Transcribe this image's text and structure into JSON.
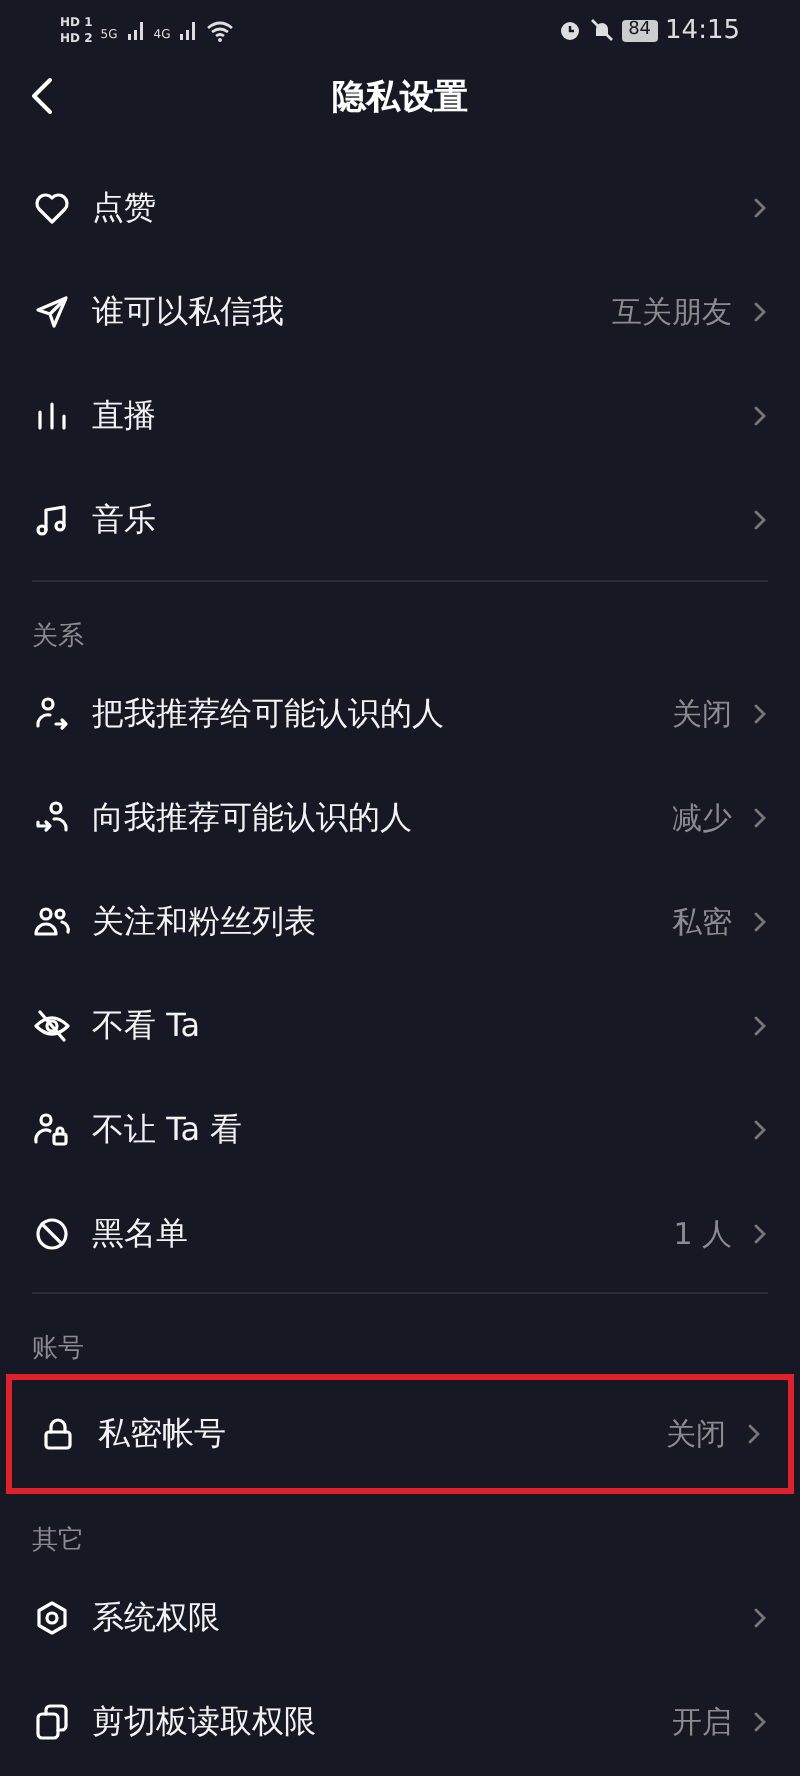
{
  "status_bar": {
    "sims": [
      {
        "badge": "HD",
        "slot": "1"
      },
      {
        "badge": "HD",
        "slot": "2"
      }
    ],
    "networks": [
      "5G",
      "4G"
    ],
    "battery": "84",
    "time": "14:15"
  },
  "header": {
    "title": "隐私设置"
  },
  "sections": [
    {
      "divider_before": false,
      "rows": [
        {
          "label": "点赞",
          "highlighted": false
        },
        {
          "label": "谁可以私信我",
          "value": "互关朋友",
          "highlighted": false
        },
        {
          "label": "直播",
          "highlighted": false
        },
        {
          "label": "音乐",
          "highlighted": false
        }
      ]
    },
    {
      "divider_before": true,
      "title": "关系",
      "rows": [
        {
          "label": "把我推荐给可能认识的人",
          "value": "关闭",
          "highlighted": false
        },
        {
          "label": "向我推荐可能认识的人",
          "value": "减少",
          "highlighted": false
        },
        {
          "label": "关注和粉丝列表",
          "value": "私密",
          "highlighted": false
        },
        {
          "label": "不看 Ta",
          "highlighted": false
        },
        {
          "label": "不让 Ta 看",
          "highlighted": false
        },
        {
          "label": "黑名单",
          "value": "1 人",
          "highlighted": false
        }
      ]
    },
    {
      "divider_before": true,
      "title": "账号",
      "rows": [
        {
          "label": "私密帐号",
          "value": "关闭",
          "highlighted": true
        }
      ]
    },
    {
      "divider_before": false,
      "title": "其它",
      "rows": [
        {
          "label": "系统权限",
          "highlighted": false
        },
        {
          "label": "剪切板读取权限",
          "value": "开启",
          "highlighted": false
        }
      ]
    }
  ]
}
